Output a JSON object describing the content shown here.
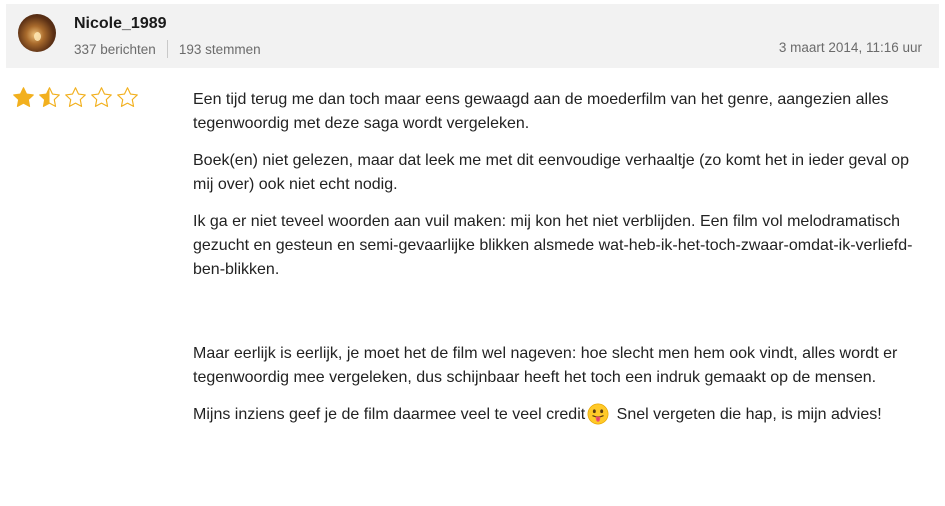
{
  "review": {
    "author": {
      "name": "Nicole_1989",
      "posts": "337 berichten",
      "votes": "193 stemmen",
      "avatar_icon": "avatar-photo"
    },
    "timestamp": "3 maart 2014, 11:16 uur",
    "rating": {
      "value": 1.5,
      "max": 5,
      "star_color": "#f2b01e"
    },
    "paragraphs": [
      "Een tijd terug me dan toch maar eens gewaagd aan de moederfilm van het genre, aangezien alles tegenwoordig met deze saga wordt vergeleken.",
      "Boek(en) niet gelezen, maar dat leek me met dit eenvoudige verhaaltje (zo komt het in ieder geval op mij over) ook niet echt nodig.",
      "Ik ga er niet teveel woorden aan vuil maken: mij kon het niet verblijden. Een film vol melodramatisch gezucht en gesteun en semi-gevaarlijke blikken alsmede wat-heb-ik-het-toch-zwaar-omdat-ik-verliefd-ben-blikken.",
      "Maar eerlijk is eerlijk, je moet het de film wel nageven: hoe slecht men hem ook vindt, alles wordt er tegenwoordig mee vergeleken, dus schijnbaar heeft het toch een indruk gemaakt op de mensen."
    ],
    "last_paragraph": {
      "before_emoji": "Mijns inziens geef je de film daarmee veel te veel credit",
      "emoji_icon": "tongue-out-emoji",
      "after_emoji": "Snel vergeten die hap, is mijn advies!"
    }
  }
}
